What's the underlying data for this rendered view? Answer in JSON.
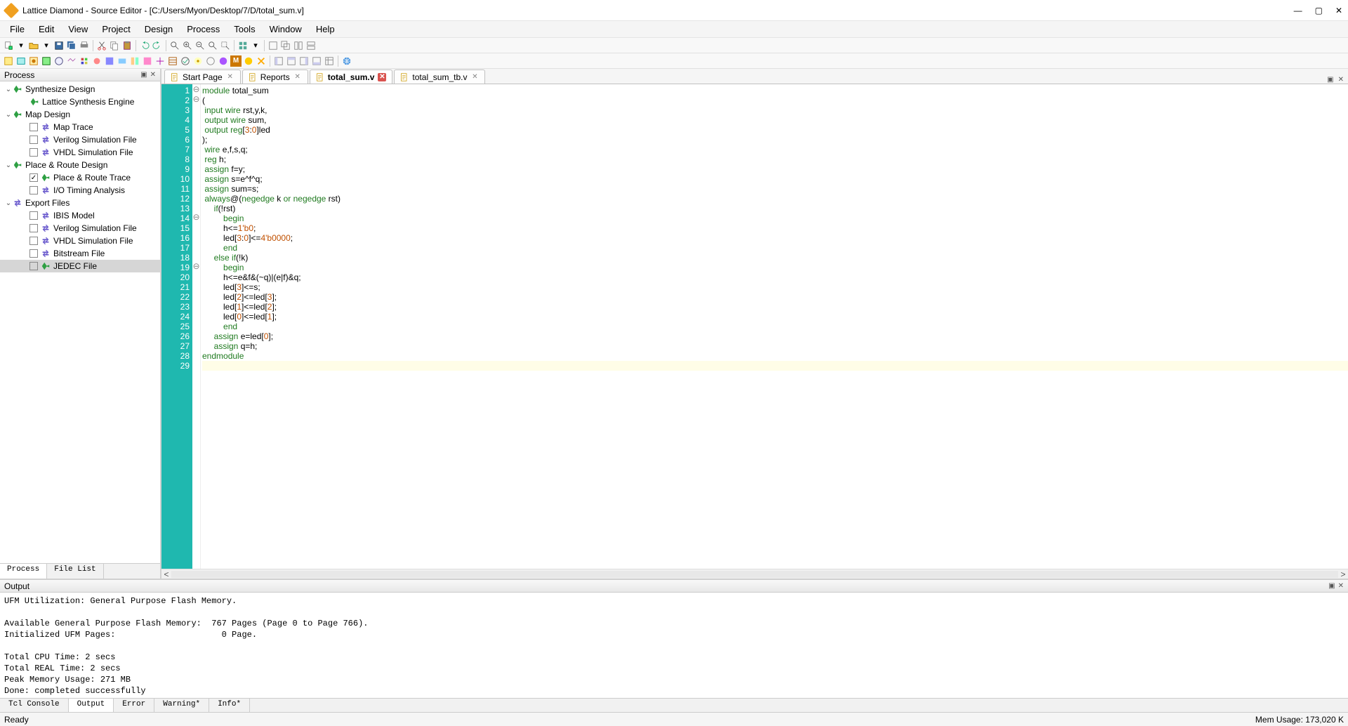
{
  "titlebar": {
    "text": "Lattice Diamond - Source Editor - [C:/Users/Myon/Desktop/7/D/total_sum.v]"
  },
  "menu": [
    "File",
    "Edit",
    "View",
    "Project",
    "Design",
    "Process",
    "Tools",
    "Window",
    "Help"
  ],
  "process_panel": {
    "title": "Process",
    "tree": [
      {
        "level": 0,
        "twisty": "v",
        "icon": "green",
        "label": "Synthesize Design"
      },
      {
        "level": 1,
        "icon": "green",
        "label": "Lattice Synthesis Engine"
      },
      {
        "level": 0,
        "twisty": "v",
        "icon": "green",
        "label": "Map Design"
      },
      {
        "level": 1,
        "cb": false,
        "icon": "arrows",
        "label": "Map Trace"
      },
      {
        "level": 1,
        "cb": false,
        "icon": "arrows",
        "label": "Verilog Simulation File"
      },
      {
        "level": 1,
        "cb": false,
        "icon": "arrows",
        "label": "VHDL Simulation File"
      },
      {
        "level": 0,
        "twisty": "v",
        "icon": "green",
        "label": "Place & Route Design"
      },
      {
        "level": 1,
        "cb": true,
        "icon": "green",
        "label": "Place & Route Trace"
      },
      {
        "level": 1,
        "cb": false,
        "icon": "arrows",
        "label": "I/O Timing Analysis"
      },
      {
        "level": 0,
        "twisty": "v",
        "icon": "arrows",
        "label": "Export Files"
      },
      {
        "level": 1,
        "cb": false,
        "icon": "arrows",
        "label": "IBIS Model"
      },
      {
        "level": 1,
        "cb": false,
        "icon": "arrows",
        "label": "Verilog Simulation File"
      },
      {
        "level": 1,
        "cb": false,
        "icon": "arrows",
        "label": "VHDL Simulation File"
      },
      {
        "level": 1,
        "cb": false,
        "icon": "arrows",
        "label": "Bitstream File"
      },
      {
        "level": 1,
        "cb": false,
        "icon": "green",
        "label": "JEDEC File",
        "selected": true
      }
    ],
    "tabs": [
      "Process",
      "File List"
    ]
  },
  "editor_tabs": [
    {
      "label": "Start Page",
      "modified": false
    },
    {
      "label": "Reports",
      "modified": false
    },
    {
      "label": "total_sum.v",
      "modified": true,
      "active": true
    },
    {
      "label": "total_sum_tb.v",
      "modified": false
    }
  ],
  "code_lines": [
    {
      "n": 1,
      "fold": "⊖",
      "html": "<span class='kw'>module</span> total_sum"
    },
    {
      "n": 2,
      "fold": "⊖",
      "html": "("
    },
    {
      "n": 3,
      "html": " <span class='kw'>input</span> <span class='kw'>wire</span> rst,y,k,"
    },
    {
      "n": 4,
      "html": " <span class='kw'>output</span> <span class='kw'>wire</span> sum,"
    },
    {
      "n": 5,
      "html": " <span class='kw'>output</span> <span class='kw'>reg</span>[<span class='num'>3</span>:<span class='num'>0</span>]led"
    },
    {
      "n": 6,
      "html": ");"
    },
    {
      "n": 7,
      "html": " <span class='kw'>wire</span> e,f,s,q;"
    },
    {
      "n": 8,
      "html": " <span class='kw'>reg</span> h;"
    },
    {
      "n": 9,
      "html": " <span class='kw'>assign</span> f=y;"
    },
    {
      "n": 10,
      "html": " <span class='kw'>assign</span> s=e^f^q;"
    },
    {
      "n": 11,
      "html": " <span class='kw'>assign</span> sum=s;"
    },
    {
      "n": 12,
      "html": " <span class='kw'>always</span>@(<span class='kw'>negedge</span> k <span class='kw'>or</span> <span class='kw'>negedge</span> rst)"
    },
    {
      "n": 13,
      "html": "     <span class='kw'>if</span>(!rst)"
    },
    {
      "n": 14,
      "fold": "⊖",
      "html": "         <span class='kw'>begin</span>"
    },
    {
      "n": 15,
      "html": "         h<=<span class='num'>1'b0</span>;"
    },
    {
      "n": 16,
      "html": "         led[<span class='num'>3</span>:<span class='num'>0</span>]<=<span class='num'>4'b0000</span>;"
    },
    {
      "n": 17,
      "html": "         <span class='kw'>end</span>"
    },
    {
      "n": 18,
      "html": "     <span class='kw'>else</span> <span class='kw'>if</span>(!k)"
    },
    {
      "n": 19,
      "fold": "⊖",
      "html": "         <span class='kw'>begin</span>"
    },
    {
      "n": 20,
      "html": "         h<=e&f&(~q)|(e|f)&q;"
    },
    {
      "n": 21,
      "html": "         led[<span class='num'>3</span>]<=s;"
    },
    {
      "n": 22,
      "html": "         led[<span class='num'>2</span>]<=led[<span class='num'>3</span>];"
    },
    {
      "n": 23,
      "html": "         led[<span class='num'>1</span>]<=led[<span class='num'>2</span>];"
    },
    {
      "n": 24,
      "html": "         led[<span class='num'>0</span>]<=led[<span class='num'>1</span>];"
    },
    {
      "n": 25,
      "html": "         <span class='kw'>end</span>"
    },
    {
      "n": 26,
      "html": "     <span class='kw'>assign</span> e=led[<span class='num'>0</span>];"
    },
    {
      "n": 27,
      "html": "     <span class='kw'>assign</span> q=h;"
    },
    {
      "n": 28,
      "html": "<span class='kw'>endmodule</span>"
    },
    {
      "n": 29,
      "html": "",
      "hl": true
    }
  ],
  "output_panel": {
    "title": "Output",
    "lines": [
      "UFM Utilization: General Purpose Flash Memory.",
      "",
      "Available General Purpose Flash Memory:  767 Pages (Page 0 to Page 766).",
      "Initialized UFM Pages:                     0 Page.",
      "",
      "Total CPU Time: 2 secs",
      "Total REAL Time: 2 secs",
      "Peak Memory Usage: 271 MB",
      "Done: completed successfully"
    ],
    "tabs": [
      "Tcl Console",
      "Output",
      "Error",
      "Warning*",
      "Info*"
    ],
    "active_tab": 1
  },
  "statusbar": {
    "left": "Ready",
    "right": "Mem Usage:  173,020 K"
  }
}
